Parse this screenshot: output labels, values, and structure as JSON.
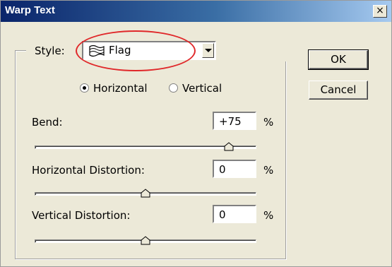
{
  "window": {
    "title": "Warp Text",
    "close_glyph": "×"
  },
  "style": {
    "label": "Style:",
    "value": "Flag",
    "icon": "flag-warp-icon"
  },
  "orientation": {
    "horizontal_label": "Horizontal",
    "vertical_label": "Vertical",
    "selected": "Horizontal"
  },
  "params": [
    {
      "label": "Bend:",
      "value": "+75",
      "unit": "%",
      "level_percent": 75
    },
    {
      "label": "Horizontal Distortion:",
      "value": "0",
      "unit": "%",
      "level_percent": 0
    },
    {
      "label": "Vertical Distortion:",
      "value": "0",
      "unit": "%",
      "level_percent": 0
    }
  ],
  "buttons": {
    "ok": "OK",
    "cancel": "Cancel"
  },
  "colors": {
    "highlight": "#e0282a",
    "titlebar": "#0a246a"
  }
}
